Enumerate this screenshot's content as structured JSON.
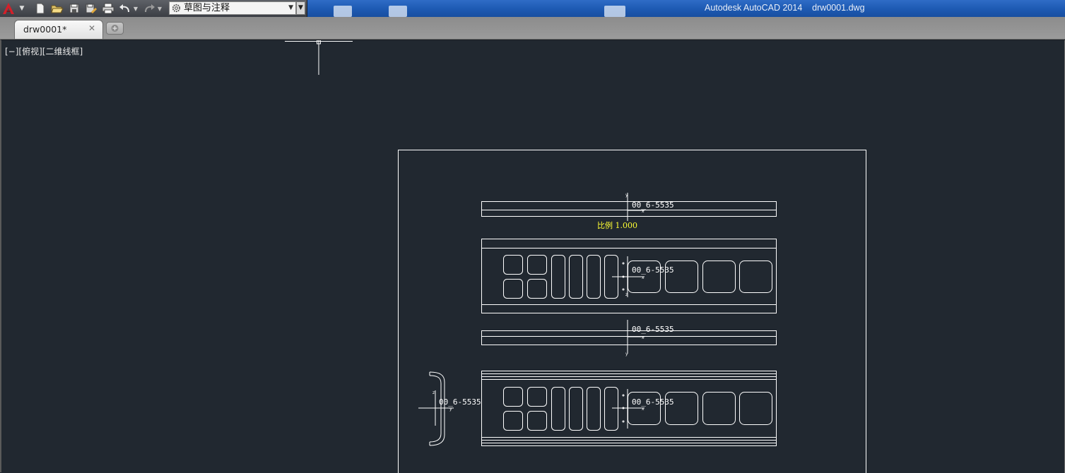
{
  "title_bar": {
    "app_title": "Autodesk AutoCAD 2014    drw0001.dwg",
    "workspace": "草图与注释",
    "quick_access": [
      "new-icon",
      "open-icon",
      "save-icon",
      "saveas-icon",
      "plot-icon",
      "undo-icon",
      "redo-icon"
    ]
  },
  "tabs": {
    "active_label": "drw0001*",
    "close_glyph": "✕"
  },
  "viewport": {
    "label": "[−][俯视][二维线框]"
  },
  "drawing": {
    "views": [
      {
        "label": "00_6-5535"
      },
      {
        "label": "00_6-5535"
      },
      {
        "label": "00_6-5535"
      },
      {
        "label": "00_6-5535"
      },
      {
        "label": "00_6-5535"
      }
    ],
    "scale_text": "比例 1.000",
    "axis_letters": {
      "x": "x",
      "y": "y",
      "z": "z"
    }
  },
  "colors": {
    "canvas_bg": "#212830",
    "title_bar": "#1e5bb4",
    "line": "#ffffff",
    "annotation": "#ffff33"
  }
}
